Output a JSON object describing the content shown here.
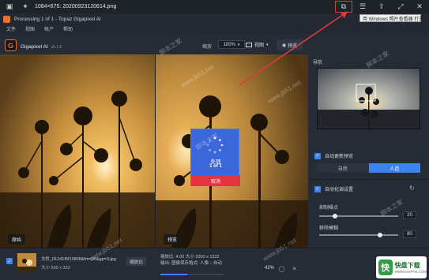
{
  "viewer": {
    "title": "1084×675: 20200923120614.png",
    "pin_icon": "pin-icon",
    "buttons": [
      "open-in-app-icon",
      "edit-icon",
      "share-icon",
      "fullscreen-icon",
      "close-icon"
    ],
    "tooltip": "用 Windows 照片查看器 打开",
    "highlight_color": "#e03b3b"
  },
  "app": {
    "title": "Processing 1 of 1 - Topaz Gigapixel AI",
    "brand": "Gigapixel AI",
    "version": "v5.1.6",
    "accent": "#e6742a"
  },
  "menu": [
    "文件",
    "视图",
    "帐户",
    "帮助"
  ],
  "toolbar": {
    "zoom_label": "缩放",
    "zoom_value": "100%",
    "view_label": "视图",
    "preview_label": "预览"
  },
  "panes": {
    "left_label": "原始",
    "right_label": "预览"
  },
  "processing": {
    "status": "处理",
    "count": "1 of 1",
    "cancel": "取消",
    "color": "#3a67d9",
    "cancel_color": "#e5343f"
  },
  "sidebar": {
    "navigator_label": "导航",
    "auto_update_preview": "自动更新预览",
    "mode_options": [
      "自然",
      "人造"
    ],
    "mode_selected": "人造",
    "auto_settings": "自动化调设置",
    "sliders": [
      {
        "label": "抑制噪点",
        "value": "20",
        "fraction": 0.2
      },
      {
        "label": "移除模糊",
        "value": "80",
        "fraction": 0.8
      }
    ]
  },
  "bottom": {
    "filename": "文件_01241f5f13808&fm=26&gp=0.jpg",
    "input_size": "大小 500 x 333",
    "change_btn": "缩放比",
    "scale_line": "缩放比: 4.00  大小 2000 x 1332",
    "output_line": "输出: 图像保存格式: 人像 ↓ 自动",
    "progress": 0.42,
    "percent": "42%",
    "accent": "#3c82f0"
  },
  "watermarks": [
    "脚本之家",
    "www.jb51.net"
  ],
  "badge": {
    "mark": "快",
    "title": "快盘下载",
    "subtitle": "WWW.KKPAN.COM"
  }
}
